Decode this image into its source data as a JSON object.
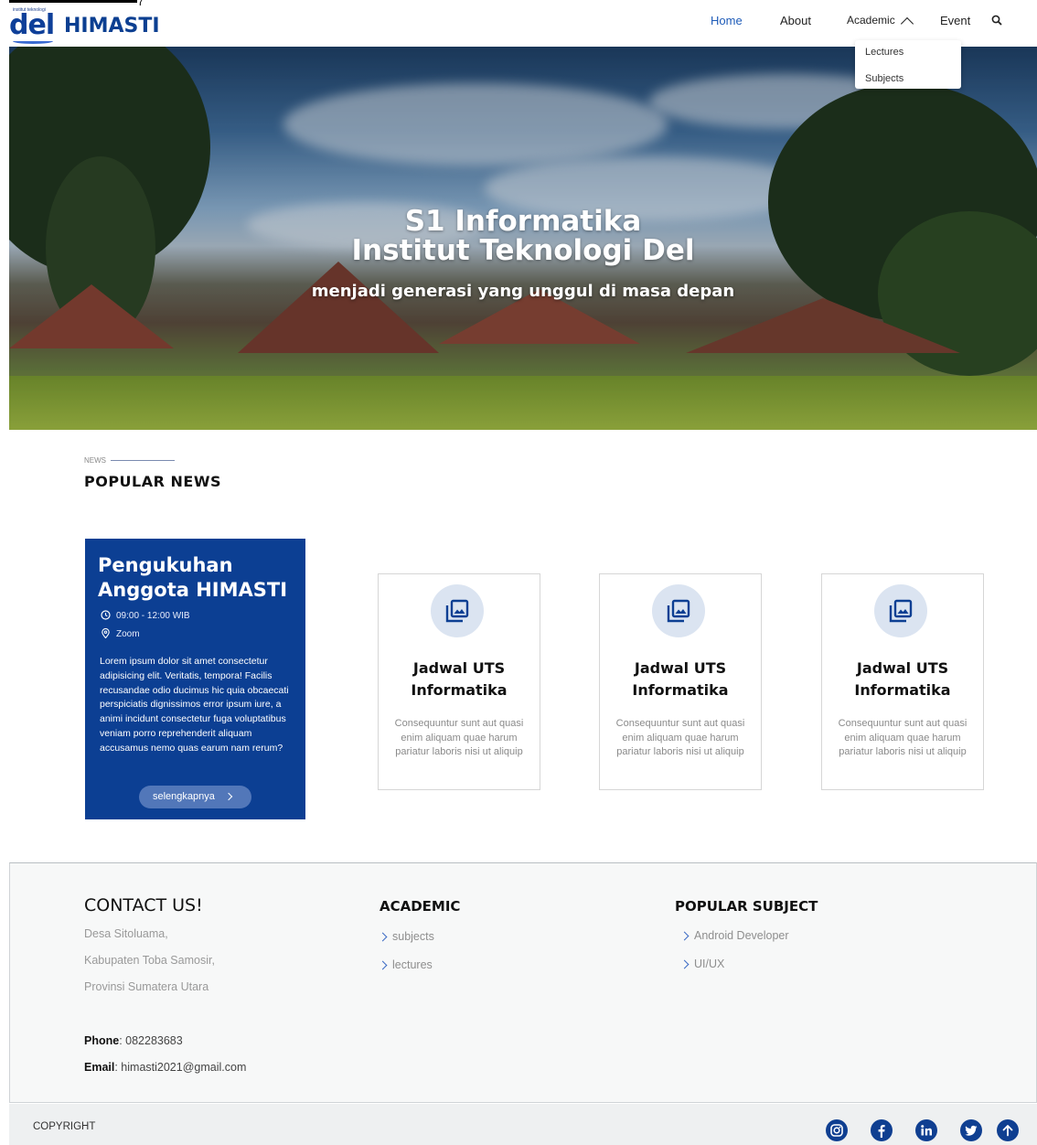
{
  "top": {
    "tail_text": "(... ...)"
  },
  "header": {
    "logo_small_text": "institut teknologi",
    "logo_text": "del",
    "brand": "HIMASTI",
    "nav": {
      "home": "Home",
      "about": "About",
      "academic": "Academic",
      "event": "Event"
    },
    "academic_dropdown": [
      "Lectures",
      "Subjects"
    ],
    "accent_color": "#1e5bb8"
  },
  "hero": {
    "title_line1": "S1 Informatika",
    "title_line2": "Institut Teknologi Del",
    "subtitle": "menjadi generasi yang unggul di masa depan"
  },
  "news": {
    "label": "NEWS",
    "title": "POPULAR NEWS",
    "feature": {
      "title_line1": "Pengukuhan",
      "title_line2": "Anggota HIMASTI",
      "time": "09:00 - 12:00 WIB",
      "location": "Zoom",
      "body": "Lorem ipsum dolor sit amet consectetur adipisicing elit. Veritatis, tempora! Facilis recusandae odio ducimus hic quia obcaecati perspiciatis dignissimos error ipsum iure, a animi incidunt consectetur fuga voluptatibus veniam porro reprehenderit aliquam accusamus nemo quas earum nam rerum?",
      "button": "selengkapnya",
      "color": "#0c3f93"
    },
    "cards": [
      {
        "title_line1": "Jadwal UTS",
        "title_line2": "Informatika",
        "desc": "Consequuntur sunt aut quasi enim aliquam quae harum pariatur laboris nisi ut aliquip",
        "icon": "image-gallery-icon"
      },
      {
        "title_line1": "Jadwal UTS",
        "title_line2": "Informatika",
        "desc": "Consequuntur sunt aut quasi enim aliquam quae harum pariatur laboris nisi ut aliquip",
        "icon": "image-gallery-icon"
      },
      {
        "title_line1": "Jadwal UTS",
        "title_line2": "Informatika",
        "desc": "Consequuntur sunt aut quasi enim aliquam quae harum pariatur laboris nisi ut aliquip",
        "icon": "image-gallery-icon"
      }
    ]
  },
  "footer": {
    "contact_title": "CONTACT US!",
    "address": [
      "Desa Sitoluama,",
      "Kabupaten Toba Samosir,",
      "Provinsi Sumatera Utara"
    ],
    "phone_label": "Phone",
    "phone": ": 082283683",
    "email_label": "Email",
    "email": ": himasti2021@gmail.com",
    "academic_title": "ACADEMIC",
    "academic_links": [
      "subjects",
      "lectures"
    ],
    "popular_title": "POPULAR SUBJECT",
    "popular_links": [
      "Android Developer",
      "UI/UX"
    ],
    "copyright": "COPYRIGHT",
    "social_icons": [
      "instagram-icon",
      "facebook-icon",
      "linkedin-icon",
      "twitter-icon",
      "arrow-up-icon"
    ]
  }
}
